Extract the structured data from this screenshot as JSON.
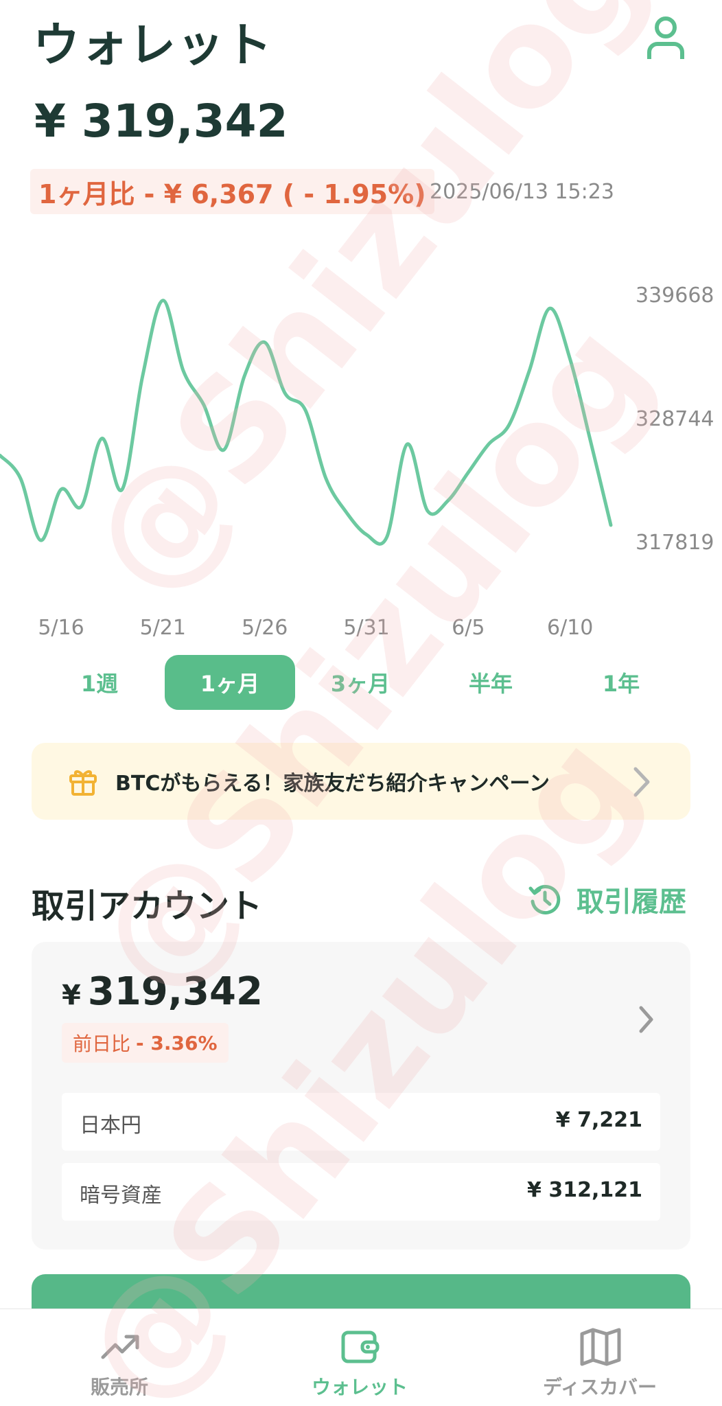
{
  "header": {
    "title": "ウォレット",
    "balance": "¥ 319,342",
    "change_text": "1ヶ月比 - ¥ 6,367 ( - 1.95%)",
    "timestamp": "2025/06/13 15:23"
  },
  "chart_data": {
    "type": "line",
    "x": [
      "5/13",
      "5/14",
      "5/15",
      "5/16",
      "5/17",
      "5/18",
      "5/19",
      "5/20",
      "5/21",
      "5/22",
      "5/23",
      "5/24",
      "5/25",
      "5/26",
      "5/27",
      "5/28",
      "5/29",
      "5/30",
      "5/31",
      "6/1",
      "6/2",
      "6/3",
      "6/4",
      "6/5",
      "6/6",
      "6/7",
      "6/8",
      "6/9",
      "6/10",
      "6/11",
      "6/12",
      "6/13"
    ],
    "values": [
      325500,
      323500,
      318000,
      322500,
      321000,
      327000,
      322500,
      332500,
      339200,
      333000,
      330000,
      326000,
      332500,
      335500,
      331000,
      329500,
      323500,
      320500,
      318500,
      318300,
      326500,
      320600,
      321500,
      324000,
      326500,
      328200,
      333000,
      338500,
      334000,
      326800,
      319342
    ],
    "x_tick_labels": [
      "5/16",
      "5/21",
      "5/26",
      "5/31",
      "6/5",
      "6/10"
    ],
    "y_tick_labels": [
      "339668",
      "328744",
      "317819"
    ],
    "ylim": [
      317819,
      339668
    ],
    "line_color": "#6cc9a0",
    "grid": false,
    "legend": false
  },
  "period_tabs": [
    {
      "label": "1週",
      "active": false
    },
    {
      "label": "1ヶ月",
      "active": true
    },
    {
      "label": "3ヶ月",
      "active": false
    },
    {
      "label": "半年",
      "active": false
    },
    {
      "label": "1年",
      "active": false
    }
  ],
  "promo": {
    "text": "BTCがもらえる！家族友だち紹介キャンペーン",
    "icon": "gift-icon"
  },
  "account_section": {
    "title": "取引アカウント",
    "history_label": "取引履歴",
    "history_icon": "history-icon"
  },
  "account_card": {
    "yen_symbol": "¥",
    "amount": "319,342",
    "day_change_label": "前日比",
    "day_change_value": "- 3.36%",
    "rows": [
      {
        "label": "日本円",
        "value": "¥ 7,221"
      },
      {
        "label": "暗号資産",
        "value": "¥ 312,121"
      }
    ]
  },
  "bottom_nav": [
    {
      "label": "販売所",
      "icon": "trend-up-icon",
      "active": false
    },
    {
      "label": "ウォレット",
      "icon": "wallet-icon",
      "active": true
    },
    {
      "label": "ディスカバー",
      "icon": "map-icon",
      "active": false
    }
  ],
  "watermark": {
    "text": "@Shizulog"
  },
  "colors": {
    "accent": "#59bd8a",
    "negative": "#e0663f",
    "title": "#1e3a34",
    "promo_bg": "#fff8e3"
  }
}
